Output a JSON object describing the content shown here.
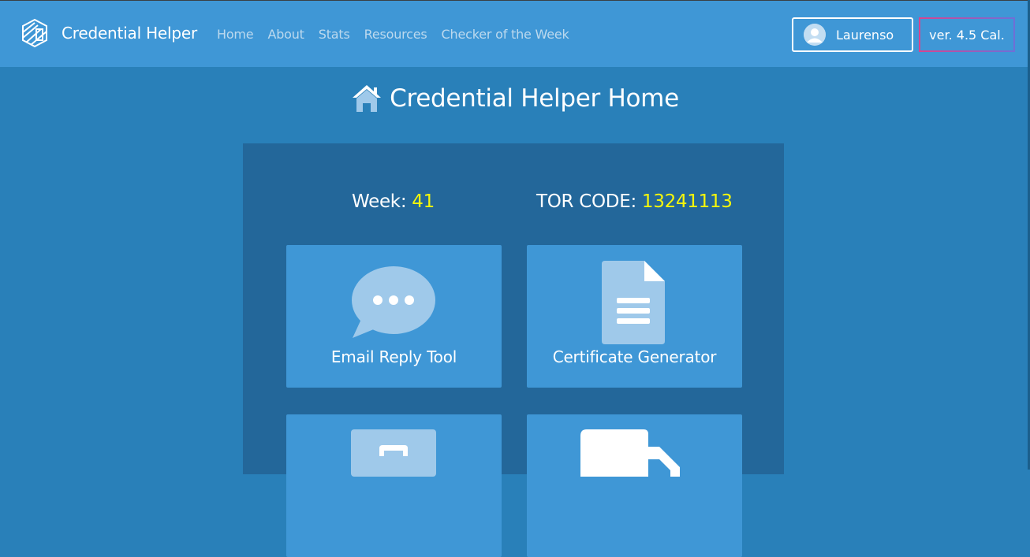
{
  "app": {
    "name": "Credential Helper",
    "logo_icon": "credential-helper-logo"
  },
  "nav": {
    "links": [
      "Home",
      "About",
      "Stats",
      "Resources",
      "Checker of the Week"
    ]
  },
  "user": {
    "name": "Laurenso",
    "icon": "user-avatar-icon"
  },
  "version": {
    "label": "ver. 4.5 Cal."
  },
  "page": {
    "title": "Credential Helper Home",
    "title_icon": "home-icon"
  },
  "info": {
    "week_label": "Week:",
    "week_value": "41",
    "tor_label": "TOR CODE:",
    "tor_value": "13241113"
  },
  "tiles": [
    {
      "label": "Email Reply Tool",
      "icon": "speech-bubble-icon"
    },
    {
      "label": "Certificate Generator",
      "icon": "document-icon"
    },
    {
      "label": "",
      "icon": "briefcase-icon"
    },
    {
      "label": "",
      "icon": "copy-icon"
    }
  ],
  "colors": {
    "navbar": "#3f97d6",
    "background": "#2980b9",
    "panel": "#23679a",
    "tile": "#3f97d6",
    "highlight": "#f7f70a",
    "version_border_start": "#d9448f",
    "version_border_end": "#6f6fd6"
  }
}
